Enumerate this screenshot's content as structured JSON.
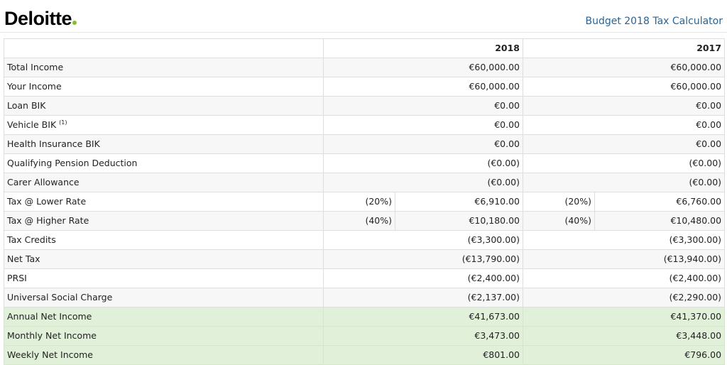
{
  "header": {
    "logo_text": "Deloitte",
    "app_title": "Budget 2018 Tax Calculator",
    "brand_colors": {
      "logo_dot": "#86bc25",
      "title_link": "#2a6496",
      "net_row_bg": "#e1f0d9"
    }
  },
  "table": {
    "columns": {
      "y2018": "2018",
      "y2017": "2017"
    },
    "rows": {
      "total_income": {
        "label": "Total Income",
        "v2018": "€60,000.00",
        "v2017": "€60,000.00"
      },
      "your_income": {
        "label": "Your Income",
        "v2018": "€60,000.00",
        "v2017": "€60,000.00"
      },
      "loan_bik": {
        "label": "Loan BIK",
        "v2018": "€0.00",
        "v2017": "€0.00"
      },
      "vehicle_bik": {
        "label": "Vehicle BIK",
        "footnote": "(1)",
        "v2018": "€0.00",
        "v2017": "€0.00"
      },
      "health_bik": {
        "label": "Health Insurance BIK",
        "v2018": "€0.00",
        "v2017": "€0.00"
      },
      "pension": {
        "label": "Qualifying Pension Deduction",
        "v2018": "(€0.00)",
        "v2017": "(€0.00)"
      },
      "carer": {
        "label": "Carer Allowance",
        "v2018": "(€0.00)",
        "v2017": "(€0.00)"
      },
      "tax_lower": {
        "label": "Tax @ Lower Rate",
        "rate2018": "(20%)",
        "v2018": "€6,910.00",
        "rate2017": "(20%)",
        "v2017": "€6,760.00"
      },
      "tax_higher": {
        "label": "Tax @ Higher Rate",
        "rate2018": "(40%)",
        "v2018": "€10,180.00",
        "rate2017": "(40%)",
        "v2017": "€10,480.00"
      },
      "tax_credits": {
        "label": "Tax Credits",
        "v2018": "(€3,300.00)",
        "v2017": "(€3,300.00)"
      },
      "net_tax": {
        "label": "Net Tax",
        "v2018": "(€13,790.00)",
        "v2017": "(€13,940.00)"
      },
      "prsi": {
        "label": "PRSI",
        "v2018": "(€2,400.00)",
        "v2017": "(€2,400.00)"
      },
      "usc": {
        "label": "Universal Social Charge",
        "v2018": "(€2,137.00)",
        "v2017": "(€2,290.00)"
      },
      "annual_net": {
        "label": "Annual Net Income",
        "v2018": "€41,673.00",
        "v2017": "€41,370.00"
      },
      "monthly_net": {
        "label": "Monthly Net Income",
        "v2018": "€3,473.00",
        "v2017": "€3,448.00"
      },
      "weekly_net": {
        "label": "Weekly Net Income",
        "v2018": "€801.00",
        "v2017": "€796.00"
      }
    }
  }
}
